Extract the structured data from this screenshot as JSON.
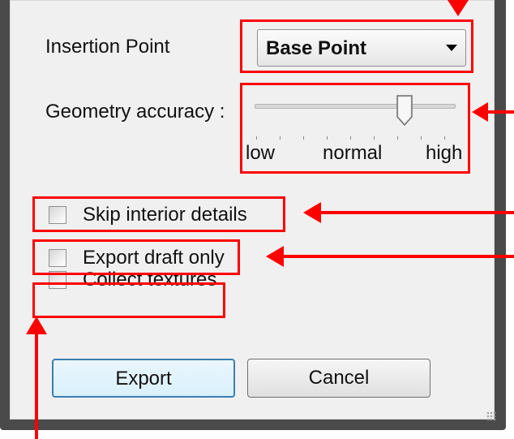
{
  "insertion_point": {
    "label": "Insertion Point",
    "selected_value": "Base Point"
  },
  "geometry_accuracy": {
    "label": "Geometry accuracy :",
    "level": 0.75,
    "ticks": [
      "low",
      "normal",
      "high"
    ]
  },
  "options": [
    {
      "label": "Skip interior details",
      "checked": false
    },
    {
      "label": "Export draft only",
      "checked": false
    },
    {
      "label": "Collect textures",
      "checked": false
    }
  ],
  "buttons": {
    "export_label": "Export",
    "cancel_label": "Cancel"
  },
  "annotation_color": "#ff0000"
}
